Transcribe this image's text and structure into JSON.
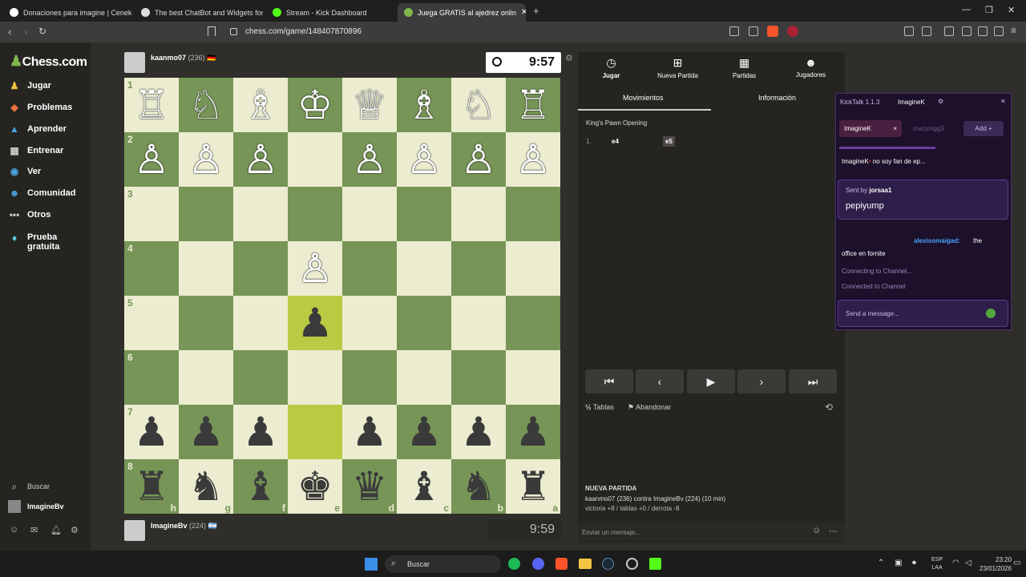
{
  "browser": {
    "tabs": [
      {
        "title": "Donaciones para imagine | Ceneka",
        "color": "#ffffff"
      },
      {
        "title": "The best ChatBot and Widgets for Ki",
        "color": "#e8e8e8"
      },
      {
        "title": "Stream - Kick Dashboard",
        "color": "#53fc18"
      },
      {
        "title": "Juega GRATIS al ajedrez onlin",
        "color": "#81b64c"
      }
    ],
    "url": "chess.com/game/148407870896"
  },
  "sidebar": {
    "logo": "Chess.com",
    "items": [
      {
        "label": "Jugar",
        "icon": "play-icon"
      },
      {
        "label": "Problemas",
        "icon": "puzzle-icon"
      },
      {
        "label": "Aprender",
        "icon": "learn-icon"
      },
      {
        "label": "Entrenar",
        "icon": "train-icon"
      },
      {
        "label": "Ver",
        "icon": "watch-icon"
      },
      {
        "label": "Comunidad",
        "icon": "community-icon"
      },
      {
        "label": "Otros",
        "icon": "more-icon"
      },
      {
        "label": "Prueba gratuita",
        "icon": "diamond-icon"
      }
    ],
    "search": "Buscar",
    "user": "ImagineBv"
  },
  "game": {
    "top_player": {
      "name": "kaanmo07",
      "rating": "(236)",
      "flag": "🇩🇪",
      "clock": "9:57"
    },
    "bottom_player": {
      "name": "ImagineBv",
      "rating": "(224)",
      "flag": "🇦🇷",
      "clock": "9:59"
    },
    "board": {
      "rows": [
        [
          "♖",
          "♘",
          "♗",
          "♔",
          "♕",
          "♗",
          "♘",
          "♖"
        ],
        [
          "♙",
          "♙",
          "♙",
          "",
          "♙",
          "♙",
          "♙",
          "♙"
        ],
        [
          "",
          "",
          "",
          "",
          "",
          "",
          "",
          ""
        ],
        [
          "",
          "",
          "",
          "♙",
          "",
          "",
          "",
          ""
        ],
        [
          "",
          "",
          "",
          "♟",
          "",
          "",
          "",
          ""
        ],
        [
          "",
          "",
          "",
          "",
          "",
          "",
          "",
          ""
        ],
        [
          "♟",
          "♟",
          "♟",
          "",
          "♟",
          "♟",
          "♟",
          "♟"
        ],
        [
          "♜",
          "♞",
          "♝",
          "♚",
          "♛",
          "♝",
          "♞",
          "♜"
        ]
      ],
      "ranks": [
        "1",
        "2",
        "3",
        "4",
        "5",
        "6",
        "7",
        "8"
      ],
      "files": [
        "h",
        "g",
        "f",
        "e",
        "d",
        "c",
        "b",
        "a"
      ]
    }
  },
  "panel": {
    "tabs": [
      {
        "label": "Jugar",
        "icon": "clock-icon"
      },
      {
        "label": "Nueva Partida",
        "icon": "plus-icon"
      },
      {
        "label": "Partidas",
        "icon": "board-icon"
      },
      {
        "label": "Jugadores",
        "icon": "players-icon"
      }
    ],
    "subtabs": [
      "Movimientos",
      "Información"
    ],
    "opening": "King's Pawn Opening",
    "moves": [
      {
        "num": "1.",
        "white": "e4",
        "black": "e5"
      }
    ],
    "draw": "Tablas",
    "resign": "Abandonar",
    "new_game_title": "NUEVA PARTIDA",
    "new_game_line1": "kaanmo07 (236) contra ImagineBv (224) (10 min)",
    "new_game_line2": "victoria +8 / tablas +0 / derrota -8",
    "chat_placeholder": "Enviar un mensaje..."
  },
  "kicktalk": {
    "title": "KickTalk 1.1.3",
    "user": "ImagineK",
    "tab_active": "ImagineK",
    "tab_other": "crazynigg3",
    "add": "Add",
    "pinned_user": "ImagineK",
    "pinned_text": "no soy fan de ep...",
    "sent_by": "Sent by",
    "sent_by_user": "jorsaa1",
    "sent_msg": "pepiyump",
    "chat_user": "alexisomaigad:",
    "chat_msg1": "the",
    "chat_msg2": "office en fornite",
    "status1": "Connecting to Channel...",
    "status2": "Connected to Channel",
    "input_placeholder": "Send a message..."
  },
  "taskbar": {
    "search": "Buscar",
    "lang1": "ESP",
    "lang2": "LAA",
    "time": "23:20",
    "date": "23/01/2026"
  }
}
